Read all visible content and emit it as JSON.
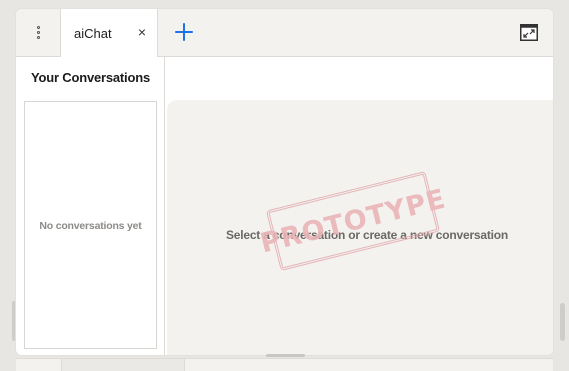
{
  "tabs": [
    {
      "label": "aiChat",
      "close_glyph": "×"
    }
  ],
  "toolbar": {
    "menu_icon": "kebab-menu-icon",
    "add_icon": "plus-icon",
    "expand_icon": "expand-window-icon"
  },
  "sidebar": {
    "title": "Your Conversations",
    "empty_text": "No conversations yet"
  },
  "main": {
    "empty_text": "Select a conversation or create a new conversation"
  },
  "watermark": {
    "text": "PROTOTYPE"
  },
  "colors": {
    "accent": "#1a73e8",
    "panel_bg": "#f4f2ef",
    "stamp": "#e9b4b7"
  }
}
